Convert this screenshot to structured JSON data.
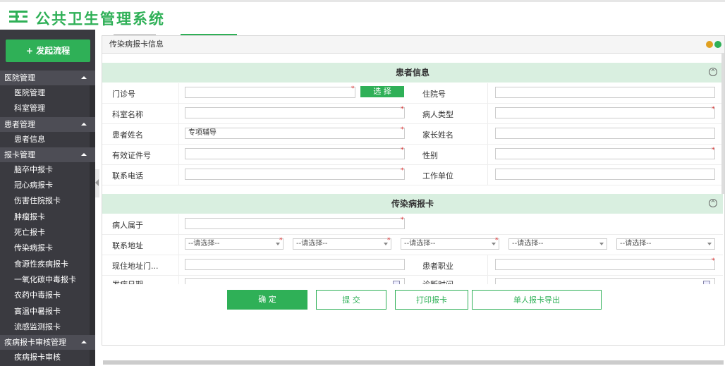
{
  "app": {
    "title": "公共卫生管理系统"
  },
  "sidebar": {
    "start_button": "+ 发起流程",
    "groups": [
      {
        "label": "医院管理",
        "items": [
          "医院管理",
          "科室管理"
        ]
      },
      {
        "label": "患者管理",
        "items": [
          "患者信息"
        ]
      },
      {
        "label": "报卡管理",
        "items": [
          "脑卒中报卡",
          "冠心病报卡",
          "伤害住院报卡",
          "肿瘤报卡",
          "死亡报卡",
          "传染病报卡",
          "食源性疾病报卡",
          "一氧化碳中毒报卡",
          "农药中毒报卡",
          "高温中暑报卡",
          "流感监测报卡"
        ]
      },
      {
        "label": "疾病报卡审核管理",
        "items": [
          "疾病报卡审核"
        ]
      }
    ]
  },
  "dialog": {
    "title": "传染病报卡信息",
    "patient_section": {
      "title": "患者信息",
      "select_button": "选 择",
      "labels": {
        "outpatient_no": "门诊号",
        "inpatient_no": "住院号",
        "dept_name": "科室名称",
        "patient_type": "病人类型",
        "patient_name": "患者姓名",
        "parent_name": "家长姓名",
        "id_no": "有效证件号",
        "gender": "性别",
        "phone": "联系电话",
        "work_unit": "工作单位"
      },
      "values": {
        "patient_name": "专项辅导"
      }
    },
    "card_section": {
      "title": "传染病报卡",
      "labels": {
        "belongs": "病人属于",
        "address": "联系地址",
        "current_address": "现住地址门...",
        "occupation": "患者职业",
        "onset_date": "发病日期",
        "diagnosis_time": "诊断时间"
      },
      "select_placeholder": "--请选择--"
    },
    "buttons": {
      "confirm": "确 定",
      "submit": "提 交",
      "print": "打印报卡",
      "export": "单人报卡导出"
    }
  },
  "colors": {
    "accent": "#2fb057",
    "sidebar_bg": "#3a3a40",
    "section_bg": "#d9efe0"
  }
}
